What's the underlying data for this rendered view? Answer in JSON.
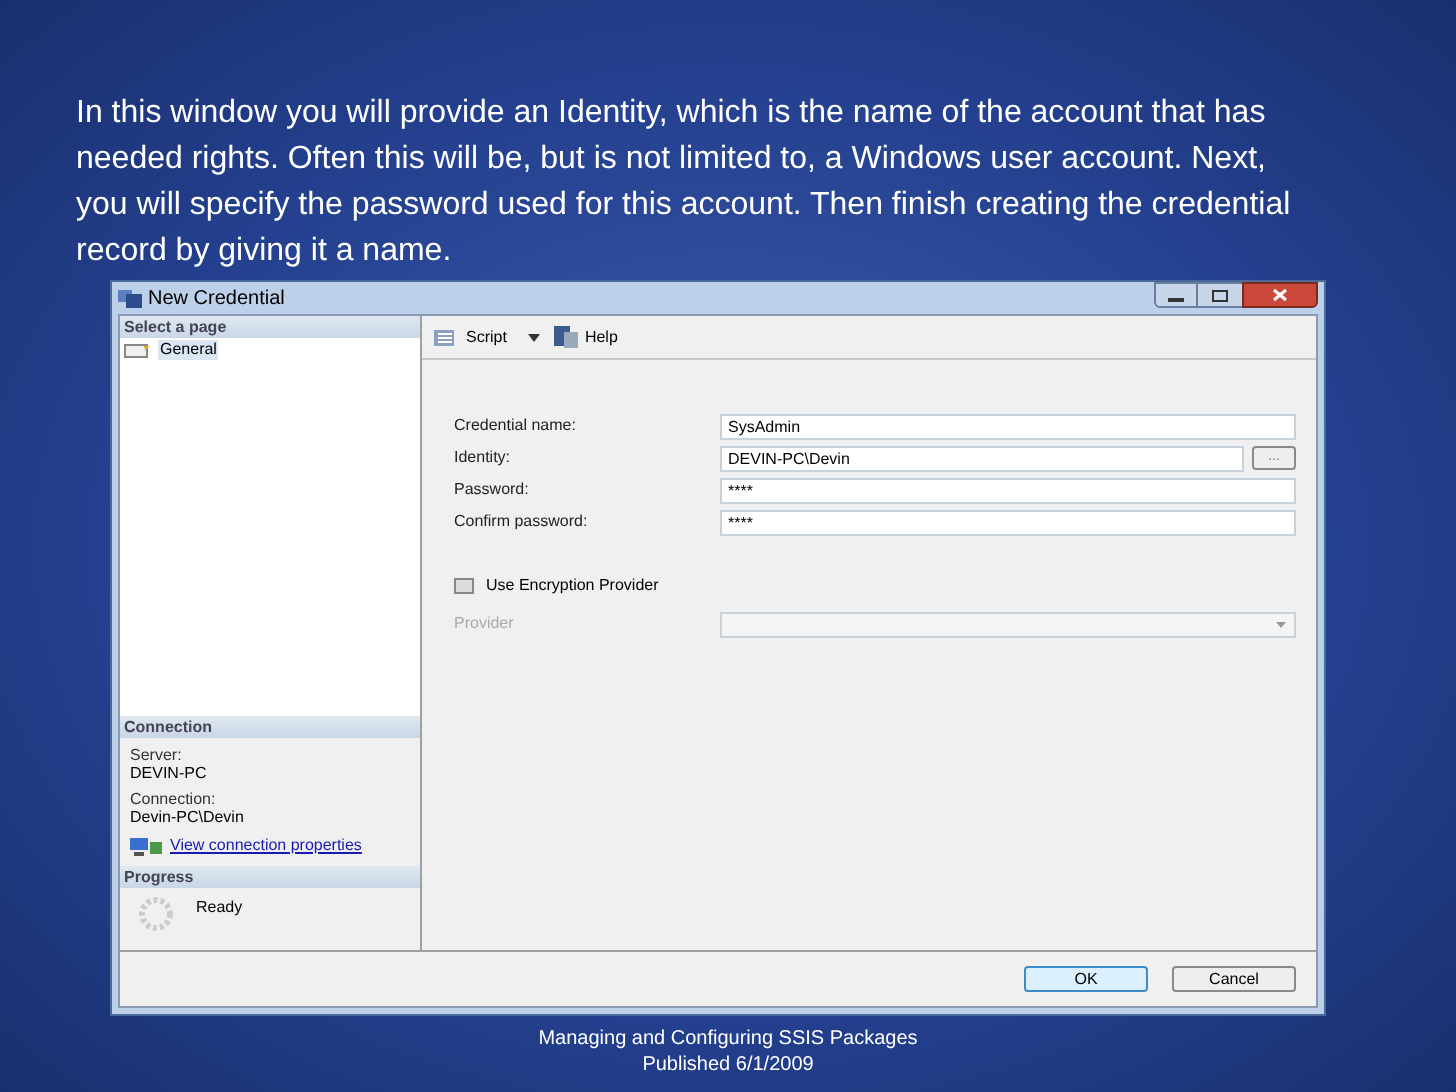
{
  "slide": {
    "body": "In this window you will provide an Identity, which is the name of the account that has needed rights. Often this will be, but is not limited to, a Windows user account. Next, you will specify the password used for this account. Then finish creating the credential record by giving it a name.",
    "footer": [
      "Managing and Configuring SSIS Packages",
      "Published 6/1/2009"
    ]
  },
  "window": {
    "title": "New Credential"
  },
  "sidebar": {
    "header": "Select a page",
    "items": [
      {
        "label": "General",
        "selected": true
      }
    ]
  },
  "connection": {
    "header": "Connection",
    "fields": [
      {
        "label": "Server:",
        "value": "DEVIN-PC"
      },
      {
        "label": "Connection:",
        "value": "Devin-PC\\Devin"
      }
    ],
    "link": "View connection properties"
  },
  "progress": {
    "header": "Progress",
    "status": "Ready"
  },
  "toolbar": [
    {
      "kind": "script",
      "label": "Script"
    },
    {
      "kind": "help",
      "label": "Help"
    }
  ],
  "form": [
    {
      "kind": "text",
      "label": "Credential name:",
      "value": "SysAdmin"
    },
    {
      "kind": "browse",
      "label": "Identity:",
      "value": "DEVIN-PC\\Devin",
      "button": "..."
    },
    {
      "kind": "text",
      "label": "Password:",
      "value": "****"
    },
    {
      "kind": "text",
      "label": "Confirm password:",
      "value": "****"
    }
  ],
  "encryption": {
    "label": "Use Encryption Provider",
    "checked": false
  },
  "provider": {
    "label": "Provider",
    "disabled": true
  },
  "buttons": [
    {
      "label": "OK",
      "default": true
    },
    {
      "label": "Cancel",
      "default": false
    }
  ]
}
